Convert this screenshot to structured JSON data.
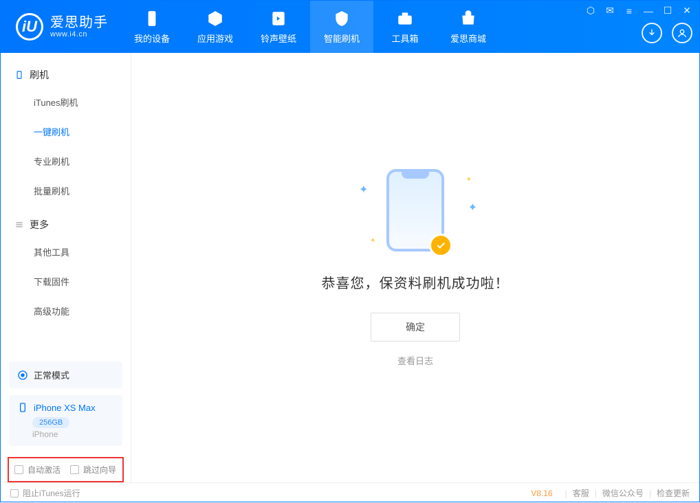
{
  "logo": {
    "title": "爱思助手",
    "sub": "www.i4.cn",
    "mark": "iU"
  },
  "tabs": [
    {
      "label": "我的设备"
    },
    {
      "label": "应用游戏"
    },
    {
      "label": "铃声壁纸"
    },
    {
      "label": "智能刷机"
    },
    {
      "label": "工具箱"
    },
    {
      "label": "爱思商城"
    }
  ],
  "sidebar": {
    "section1": "刷机",
    "items1": [
      "iTunes刷机",
      "一键刷机",
      "专业刷机",
      "批量刷机"
    ],
    "section2": "更多",
    "items2": [
      "其他工具",
      "下载固件",
      "高级功能"
    ]
  },
  "mode": {
    "label": "正常模式"
  },
  "device": {
    "name": "iPhone XS Max",
    "storage": "256GB",
    "type": "iPhone"
  },
  "options": {
    "autoActivate": "自动激活",
    "skipGuide": "跳过向导"
  },
  "main": {
    "success": "恭喜您，保资料刷机成功啦！",
    "ok": "确定",
    "viewLog": "查看日志"
  },
  "status": {
    "blockItunes": "阻止iTunes运行",
    "version": "V8.16",
    "support": "客服",
    "wechat": "微信公众号",
    "update": "检查更新"
  }
}
